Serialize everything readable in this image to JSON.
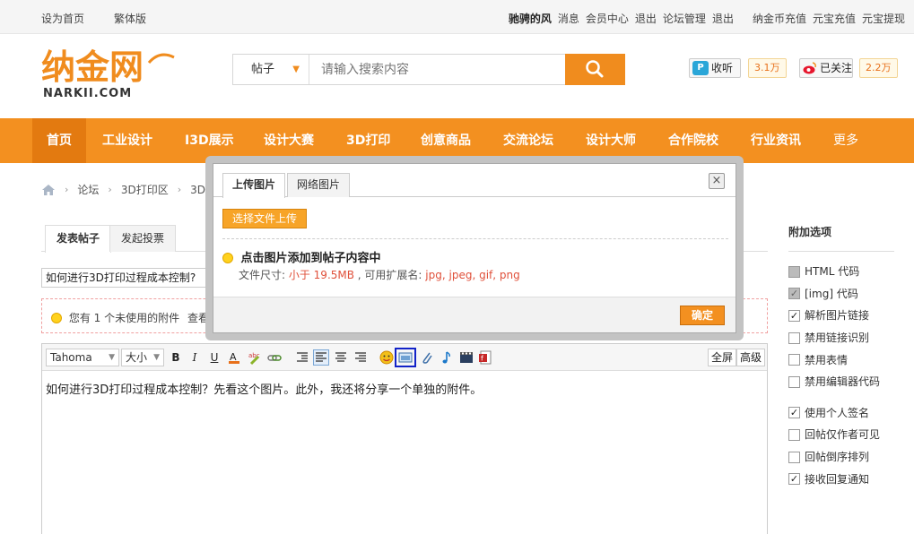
{
  "topbar": {
    "left_links": [
      "设为首页",
      "繁体版"
    ],
    "user": "驰骋的风",
    "links": [
      "消息",
      "会员中心",
      "退出",
      "论坛管理",
      "退出"
    ],
    "right_links": [
      "纳金币充值",
      "元宝充值",
      "元宝提现"
    ]
  },
  "header": {
    "logo_text": "纳金网",
    "logo_sub": "NARKII.COM",
    "search_scope": "帖子",
    "search_placeholder": "请输入搜索内容",
    "listen_label": "收听",
    "listen_count": "3.1万",
    "follow_label": "已关注",
    "follow_count": "2.2万"
  },
  "nav": {
    "items": [
      "首页",
      "工业设计",
      "I3D展示",
      "设计大赛",
      "3D打印",
      "创意商品",
      "交流论坛",
      "设计大师",
      "合作院校",
      "行业资讯",
      "更多"
    ]
  },
  "breadcrumb": [
    "论坛",
    "3D打印区",
    "3D打印"
  ],
  "post_tabs": [
    "发表帖子",
    "发起投票"
  ],
  "post_title": "如何进行3D打印过程成本控制?",
  "attach_bar": {
    "tip": "您有 1 个未使用的附件",
    "view": "查看"
  },
  "editor": {
    "font": "Tahoma",
    "size": "大小",
    "fullscreen": "全屏",
    "advanced": "高级",
    "content": "如何进行3D打印过程成本控制？先看这个图片。此外，我还将分享一个单独的附件。"
  },
  "side_options": {
    "title": "附加选项",
    "options": [
      {
        "label": "HTML 代码",
        "checked": false,
        "disabled": true
      },
      {
        "label": "[img] 代码",
        "checked": true,
        "disabled": true
      },
      {
        "label": "解析图片链接",
        "checked": true,
        "disabled": false
      },
      {
        "label": "禁用链接识别",
        "checked": false,
        "disabled": false
      },
      {
        "label": "禁用表情",
        "checked": false,
        "disabled": false
      },
      {
        "label": "禁用编辑器代码",
        "checked": false,
        "disabled": false
      },
      {
        "label": "使用个人签名",
        "checked": true,
        "disabled": false
      },
      {
        "label": "回帖仅作者可见",
        "checked": false,
        "disabled": false
      },
      {
        "label": "回帖倒序排列",
        "checked": false,
        "disabled": false
      },
      {
        "label": "接收回复通知",
        "checked": true,
        "disabled": false
      }
    ]
  },
  "modal": {
    "tabs": [
      "上传图片",
      "网络图片"
    ],
    "close": "×",
    "upload_button": "选择文件上传",
    "tip": "点击图片添加到帖子内容中",
    "desc_prefix": "文件尺寸: ",
    "desc_size": "小于 19.5MB",
    "desc_mid": " , 可用扩展名: ",
    "desc_ext": "jpg, jpeg, gif, png",
    "ok": "确定"
  },
  "colors": {
    "accent": "#f39020",
    "nav_active": "#e37a10"
  }
}
